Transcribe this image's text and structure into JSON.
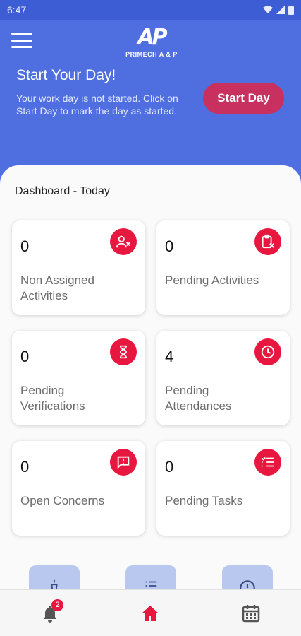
{
  "status_bar": {
    "time": "6:47"
  },
  "header": {
    "logo_mark": "AP",
    "logo_text": "PRIMECH A & P"
  },
  "start_day": {
    "title": "Start Your Day!",
    "description": "Your work day is not started. Click on Start Day to mark the day as started.",
    "button_label": "Start Day"
  },
  "dashboard": {
    "title": "Dashboard - Today",
    "cards": [
      {
        "count": "0",
        "label": "Non Assigned Activities",
        "icon": "person-remove-icon"
      },
      {
        "count": "0",
        "label": "Pending Activities",
        "icon": "clipboard-x-icon"
      },
      {
        "count": "0",
        "label": "Pending Verifications",
        "icon": "hourglass-icon"
      },
      {
        "count": "4",
        "label": "Pending Attendances",
        "icon": "clock-icon"
      },
      {
        "count": "0",
        "label": "Open Concerns",
        "icon": "message-alert-icon"
      },
      {
        "count": "0",
        "label": "Pending Tasks",
        "icon": "checklist-icon"
      }
    ]
  },
  "bottom_nav": {
    "notification_badge": "2",
    "active_tab": "home"
  },
  "colors": {
    "header_blue": "#4f6fe0",
    "start_button": "#c8305f",
    "accent_red": "#e8173f",
    "panel_bg": "#fafafa"
  }
}
